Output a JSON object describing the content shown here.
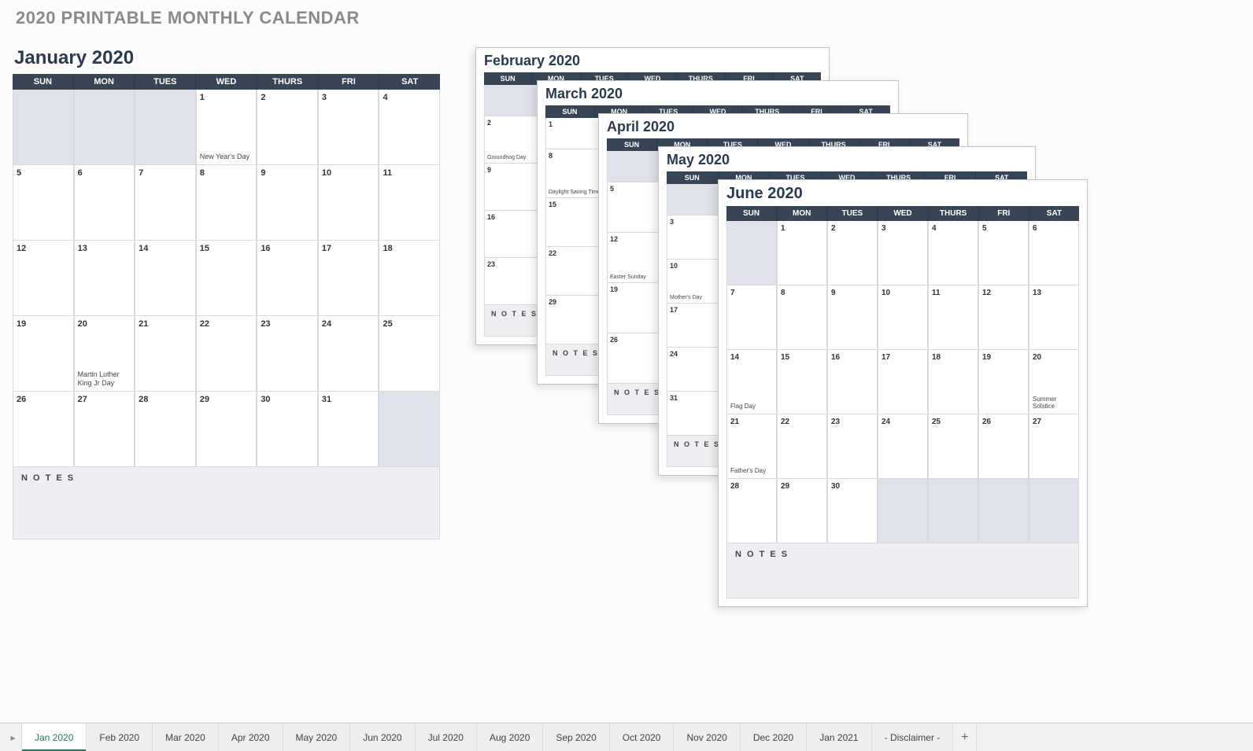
{
  "title": "2020 PRINTABLE MONTHLY CALENDAR",
  "weekdays": [
    "SUN",
    "MON",
    "TUES",
    "WED",
    "THURS",
    "FRI",
    "SAT"
  ],
  "notes_label": "N O T E S",
  "main": {
    "month": "January 2020",
    "rows": [
      [
        {
          "n": "",
          "off": true
        },
        {
          "n": "",
          "off": true
        },
        {
          "n": "",
          "off": true
        },
        {
          "n": "1",
          "note": "New Year's Day"
        },
        {
          "n": "2"
        },
        {
          "n": "3"
        },
        {
          "n": "4"
        }
      ],
      [
        {
          "n": "5"
        },
        {
          "n": "6"
        },
        {
          "n": "7"
        },
        {
          "n": "8"
        },
        {
          "n": "9"
        },
        {
          "n": "10"
        },
        {
          "n": "11"
        }
      ],
      [
        {
          "n": "12"
        },
        {
          "n": "13"
        },
        {
          "n": "14"
        },
        {
          "n": "15"
        },
        {
          "n": "16"
        },
        {
          "n": "17"
        },
        {
          "n": "18"
        }
      ],
      [
        {
          "n": "19"
        },
        {
          "n": "20",
          "note": "Martin Luther King Jr Day"
        },
        {
          "n": "21"
        },
        {
          "n": "22"
        },
        {
          "n": "23"
        },
        {
          "n": "24"
        },
        {
          "n": "25"
        }
      ],
      [
        {
          "n": "26"
        },
        {
          "n": "27"
        },
        {
          "n": "28"
        },
        {
          "n": "29"
        },
        {
          "n": "30"
        },
        {
          "n": "31"
        },
        {
          "n": "",
          "off": true
        }
      ]
    ]
  },
  "cards": {
    "feb": {
      "month": "February 2020",
      "col": [
        {
          "n": "2",
          "note": "Groundhog Day"
        },
        {
          "n": "9"
        },
        {
          "n": "16"
        },
        {
          "n": "23"
        }
      ]
    },
    "mar": {
      "month": "March 2020",
      "col": [
        {
          "n": "8",
          "note": "Daylight Saving Time Begins"
        },
        {
          "n": "15"
        },
        {
          "n": "22"
        },
        {
          "n": "29"
        }
      ]
    },
    "apr": {
      "month": "April 2020",
      "col": [
        {
          "n": "5"
        },
        {
          "n": "12",
          "note": "Easter Sunday"
        },
        {
          "n": "19"
        },
        {
          "n": "26"
        }
      ]
    },
    "may": {
      "month": "May 2020",
      "col": [
        {
          "n": "3"
        },
        {
          "n": "10",
          "note": "Mother's Day"
        },
        {
          "n": "17"
        },
        {
          "n": "24"
        },
        {
          "n": "31"
        }
      ]
    },
    "jun": {
      "month": "June 2020",
      "rows": [
        [
          {
            "n": "",
            "off": true
          },
          {
            "n": "1"
          },
          {
            "n": "2"
          },
          {
            "n": "3"
          },
          {
            "n": "4"
          },
          {
            "n": "5"
          },
          {
            "n": "6"
          }
        ],
        [
          {
            "n": "7"
          },
          {
            "n": "8"
          },
          {
            "n": "9"
          },
          {
            "n": "10"
          },
          {
            "n": "11"
          },
          {
            "n": "12"
          },
          {
            "n": "13"
          }
        ],
        [
          {
            "n": "14",
            "note": "Flag Day"
          },
          {
            "n": "15"
          },
          {
            "n": "16"
          },
          {
            "n": "17"
          },
          {
            "n": "18"
          },
          {
            "n": "19"
          },
          {
            "n": "20",
            "note": "Summer Solstice"
          }
        ],
        [
          {
            "n": "21",
            "note": "Father's Day"
          },
          {
            "n": "22"
          },
          {
            "n": "23"
          },
          {
            "n": "24"
          },
          {
            "n": "25"
          },
          {
            "n": "26"
          },
          {
            "n": "27"
          }
        ],
        [
          {
            "n": "28"
          },
          {
            "n": "29"
          },
          {
            "n": "30"
          },
          {
            "n": "",
            "off": true
          },
          {
            "n": "",
            "off": true
          },
          {
            "n": "",
            "off": true
          },
          {
            "n": "",
            "off": true
          }
        ]
      ]
    }
  },
  "tabs": [
    "Jan 2020",
    "Feb 2020",
    "Mar 2020",
    "Apr 2020",
    "May 2020",
    "Jun 2020",
    "Jul 2020",
    "Aug 2020",
    "Sep 2020",
    "Oct 2020",
    "Nov 2020",
    "Dec 2020",
    "Jan 2021",
    "- Disclaimer -"
  ],
  "active_tab": 0,
  "add_tab_label": "+"
}
